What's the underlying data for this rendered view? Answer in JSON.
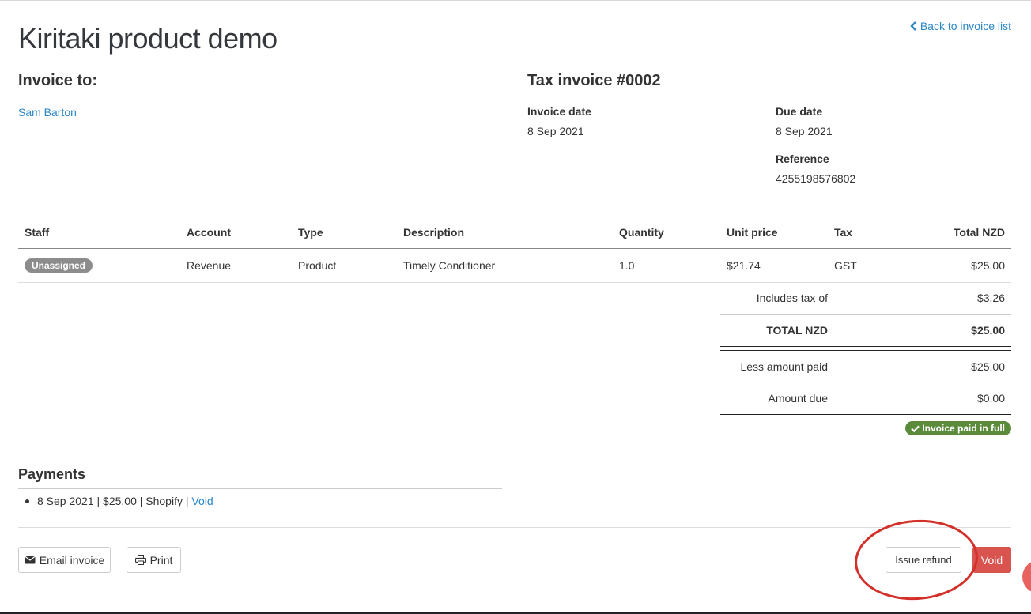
{
  "header": {
    "title": "Kiritaki product demo",
    "back_link": "Back to invoice list"
  },
  "invoice_to": {
    "heading": "Invoice to:",
    "client_name": "Sam Barton"
  },
  "invoice": {
    "heading": "Tax invoice #0002",
    "invoice_date_label": "Invoice date",
    "invoice_date": "8 Sep 2021",
    "due_date_label": "Due date",
    "due_date": "8 Sep 2021",
    "reference_label": "Reference",
    "reference": "4255198576802"
  },
  "table": {
    "headers": {
      "staff": "Staff",
      "account": "Account",
      "type": "Type",
      "description": "Description",
      "quantity": "Quantity",
      "unit_price": "Unit price",
      "tax": "Tax",
      "total": "Total NZD"
    },
    "rows": [
      {
        "staff": "Unassigned",
        "account": "Revenue",
        "type": "Product",
        "description": "Timely Conditioner",
        "quantity": "1.0",
        "unit_price": "$21.74",
        "tax": "GST",
        "total": "$25.00"
      }
    ]
  },
  "totals": {
    "includes_tax_label": "Includes tax of",
    "includes_tax_value": "$3.26",
    "total_label": "TOTAL NZD",
    "total_value": "$25.00",
    "less_paid_label": "Less amount paid",
    "less_paid_value": "$25.00",
    "amount_due_label": "Amount due",
    "amount_due_value": "$0.00"
  },
  "status_badge": "Invoice paid in full",
  "payments": {
    "heading": "Payments",
    "items": [
      {
        "text": "8 Sep 2021 | $25.00 | Shopify | ",
        "void_label": "Void"
      }
    ]
  },
  "actions": {
    "email": "Email invoice",
    "print": "Print",
    "issue_refund": "Issue refund",
    "void": "Void"
  },
  "colors": {
    "link": "#2a86c6",
    "paid_badge": "#5a8a3a",
    "void_button": "#d9534f",
    "annotation": "#d3302a"
  },
  "icons": [
    "chevron-left-icon",
    "check-icon",
    "envelope-icon",
    "printer-icon"
  ]
}
